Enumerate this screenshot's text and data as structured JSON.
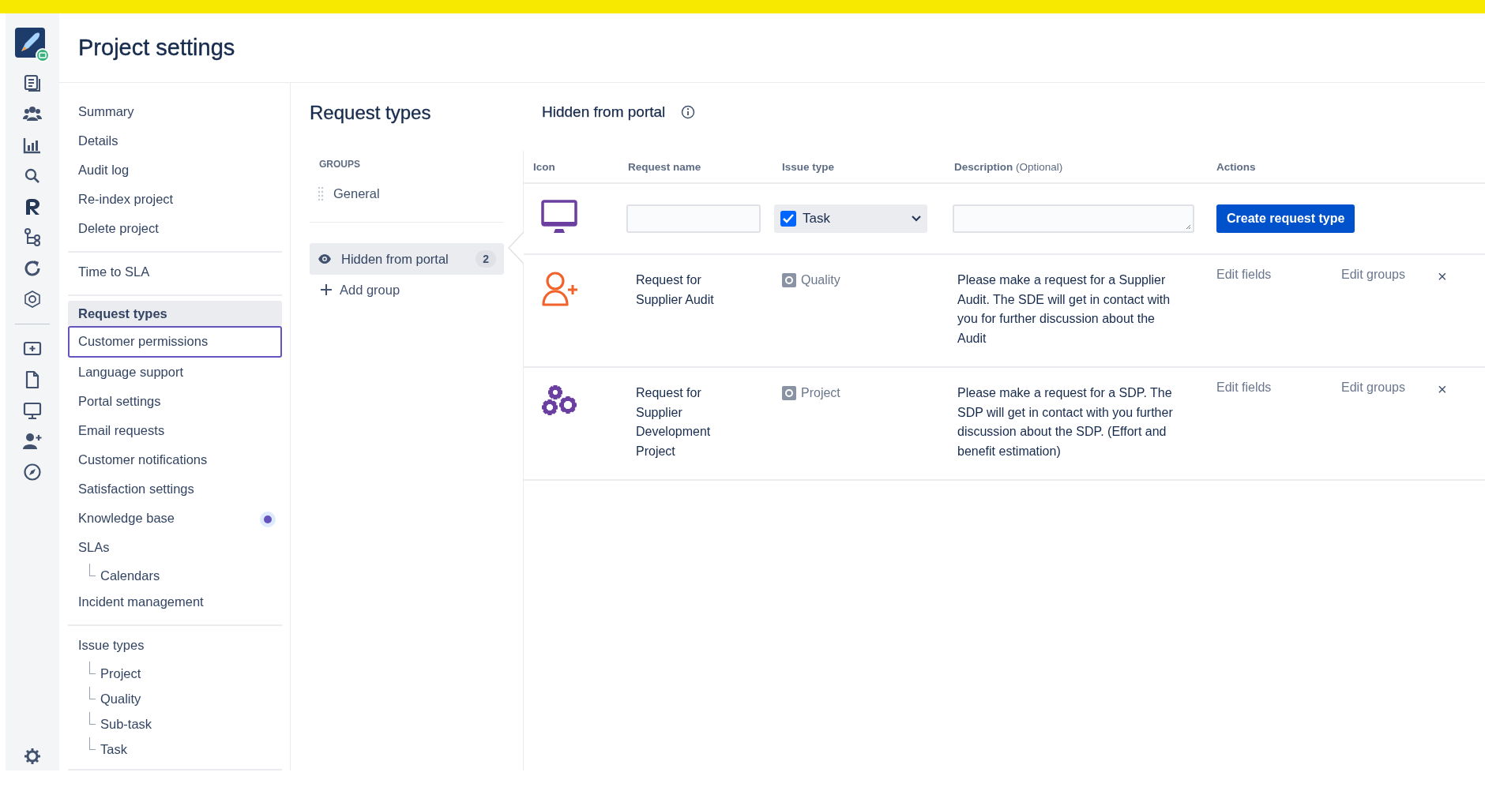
{
  "page": {
    "title": "Project settings"
  },
  "nav": {
    "sections": [
      {
        "items": [
          {
            "label": "Summary",
            "selected": false,
            "focused": false
          },
          {
            "label": "Details",
            "selected": false,
            "focused": false
          },
          {
            "label": "Audit log",
            "selected": false,
            "focused": false
          },
          {
            "label": "Re-index project",
            "selected": false,
            "focused": false
          },
          {
            "label": "Delete project",
            "selected": false,
            "focused": false
          }
        ]
      },
      {
        "items": [
          {
            "label": "Time to SLA",
            "selected": false,
            "focused": false
          }
        ]
      },
      {
        "items": [
          {
            "label": "Request types",
            "selected": true,
            "focused": false
          },
          {
            "label": "Customer permissions",
            "selected": false,
            "focused": true
          },
          {
            "label": "Language support",
            "selected": false,
            "focused": false
          },
          {
            "label": "Portal settings",
            "selected": false,
            "focused": false
          },
          {
            "label": "Email requests",
            "selected": false,
            "focused": false
          },
          {
            "label": "Customer notifications",
            "selected": false,
            "focused": false
          },
          {
            "label": "Satisfaction settings",
            "selected": false,
            "focused": false
          },
          {
            "label": "Knowledge base",
            "selected": false,
            "focused": false,
            "on": true
          },
          {
            "label": "SLAs",
            "selected": false,
            "focused": false,
            "children": [
              {
                "label": "Calendars",
                "selected": false,
                "focused": false
              }
            ]
          },
          {
            "label": "Incident management",
            "selected": false,
            "focused": false
          }
        ]
      },
      {
        "items": [
          {
            "label": "Issue types",
            "selected": false,
            "focused": false,
            "children": [
              {
                "label": "Project",
                "selected": false,
                "focused": false
              },
              {
                "label": "Quality",
                "selected": false,
                "focused": false
              },
              {
                "label": "Sub-task",
                "selected": false,
                "focused": false
              },
              {
                "label": "Task",
                "selected": false,
                "focused": false
              }
            ]
          }
        ]
      }
    ]
  },
  "request_types": {
    "title": "Request types",
    "groups_heading": "GROUPS",
    "groups": [
      {
        "label": "General",
        "selected": false,
        "kind": "draggable"
      },
      {
        "label": "Hidden from portal",
        "selected": true,
        "kind": "hidden",
        "count": "2"
      }
    ],
    "add_group": "Add group"
  },
  "table": {
    "title": "Hidden from portal",
    "columns": [
      {
        "label": "Icon"
      },
      {
        "label": "Request name"
      },
      {
        "label": "Issue type"
      },
      {
        "label": "Description",
        "note": "(Optional)"
      },
      {
        "label": "Actions"
      }
    ],
    "new_row": {
      "issue_type": {
        "value": "Task",
        "checked": true
      },
      "button": "Create request type"
    },
    "rows": [
      {
        "name": "Request for Supplier Audit",
        "issue_type": "Quality",
        "description": "Please make a request for a Supplier Audit. The SDE will get in contact with you for further discussion about the Audit",
        "actions": [
          "Edit fields",
          "Edit groups"
        ],
        "delete": "×"
      },
      {
        "name": "Request for Supplier Development Project",
        "issue_type": "Project",
        "description": "Please make a request for a SDP. The SDP will get in contact with you further discussion about the SDP. (Effort and benefit estimation)",
        "actions": [
          "Edit fields",
          "Edit groups"
        ],
        "delete": "×"
      }
    ]
  }
}
